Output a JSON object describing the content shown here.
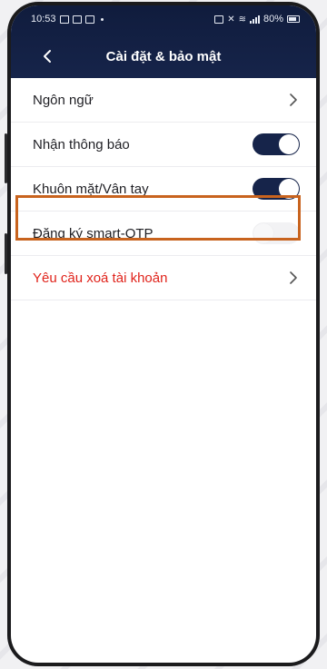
{
  "status_bar": {
    "time": "10:53",
    "battery": "80%"
  },
  "header": {
    "title": "Cài đặt & bảo mật"
  },
  "settings": {
    "language_label": "Ngôn ngữ",
    "notifications_label": "Nhận thông báo",
    "notifications_on": true,
    "biometrics_label": "Khuôn mặt/Vân tay",
    "biometrics_on": true,
    "smart_otp_label": "Đăng ký smart-OTP",
    "smart_otp_on": false,
    "delete_account_label": "Yêu cầu xoá tài khoản"
  },
  "colors": {
    "header_bg": "#16244a",
    "toggle_on": "#16244a",
    "danger_text": "#e0231b",
    "highlight_border": "#c8631e"
  }
}
